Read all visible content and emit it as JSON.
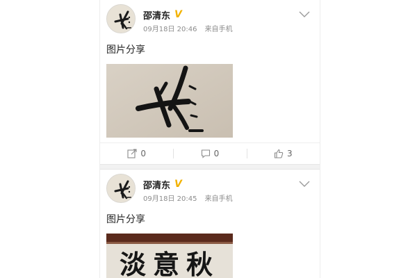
{
  "posts": [
    {
      "user": "邵清东",
      "badge": "V",
      "time": "09月18日 20:46",
      "source": "来自手机",
      "text": "图片分享",
      "repost_count": "0",
      "comment_count": "0",
      "like_count": "3"
    },
    {
      "user": "邵清东",
      "badge": "V",
      "time": "09月18日 20:45",
      "source": "来自手机",
      "text": "图片分享",
      "image_text": "淡意秋"
    }
  ],
  "colors": {
    "badge": "#f2b200",
    "meta": "#8c8c8c",
    "divider": "#eeeeee"
  }
}
